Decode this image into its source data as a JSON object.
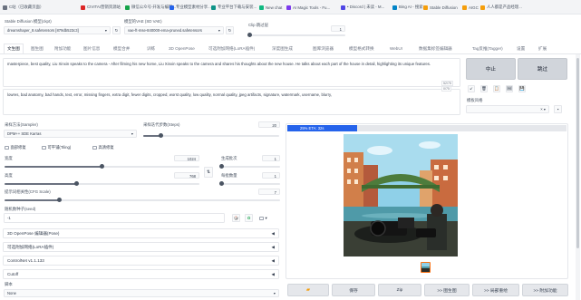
{
  "bookmarks": [
    {
      "label": "C站（已收藏页面）",
      "color": "#6b7280"
    },
    {
      "label": "CIVITAI营销资源站",
      "color": "#dc2626"
    },
    {
      "label": "微信公众号-开发与编辑...",
      "color": "#16a34a"
    },
    {
      "label": "专业模型素材分享...",
      "color": "#2563eb"
    },
    {
      "label": "专业平台下载与安装...",
      "color": "#0d9488"
    },
    {
      "label": "有工具站 - 网络课程...",
      "color": "#ea580c"
    },
    {
      "label": "New chat",
      "color": "#10b981"
    },
    {
      "label": "AI Magic Tools - Fu...",
      "color": "#7c3aed"
    },
    {
      "label": "• Discord | 未读 - M...",
      "color": "#4f46e5"
    },
    {
      "label": "Bing AI - 搜索",
      "color": "#0284c7"
    },
    {
      "label": "Stable Diffusion",
      "color": "#f59e0b"
    },
    {
      "label": "AIGC",
      "color": "#f59e0b"
    },
    {
      "label": "人人都是产品经理...",
      "color": "#f59e0b"
    }
  ],
  "header": {
    "checkpoint_label": "Stable Diffusion 模型(ckpt)",
    "checkpoint_value": "dreamshaper_8.safetensors [879db523c3]",
    "vae_label": "模型的VAE (SD VAE)",
    "vae_value": "vae-ft-mse-840000-ema-pruned.safetensors",
    "clip_label": "Clip 跳过层",
    "clip_value": "1"
  },
  "tabs": [
    {
      "label": "文生图",
      "active": true
    },
    {
      "label": "图生图",
      "active": false
    },
    {
      "label": "附加功能",
      "active": false
    },
    {
      "label": "图片信息",
      "active": false
    },
    {
      "label": "模型合并",
      "active": false
    },
    {
      "label": "训练",
      "active": false
    },
    {
      "label": "3D OpenPose",
      "active": false
    },
    {
      "label": "可选附加网络(LoRA插件)",
      "active": false
    },
    {
      "label": "深度图生成",
      "active": false
    },
    {
      "label": "图库浏览器",
      "active": false
    },
    {
      "label": "模型格式转换",
      "active": false
    },
    {
      "label": "WebUI",
      "active": false
    },
    {
      "label": "数据集标签编辑器",
      "active": false
    },
    {
      "label": "Tag反推(Tagger)",
      "active": false
    },
    {
      "label": "设置",
      "active": false
    },
    {
      "label": "扩展",
      "active": false
    }
  ],
  "prompt": {
    "positive": "masterpiece, best quality, Liu Xinxin speaks to the camera - After filming his new home, Liu Xinxin speaks to the camera and shares his thoughts about the new house. He talks about each part of the house in detail, highlighting its unique features.",
    "positive_count": "52/75",
    "negative": "lowres, bad anatomy, bad hands, text, error, missing fingers, extra digit, fewer digits, cropped, worst quality, low quality, normal quality, jpeg artifacts, signature, watermark, username, blurry,",
    "negative_count": "0/75"
  },
  "actions": {
    "generate": "生成",
    "interrupt": "中止",
    "skip": "跳过",
    "styles_label": "模板风格",
    "tool_icons": [
      "↙",
      "🗑",
      "📋",
      "🖼",
      "💾"
    ]
  },
  "params": {
    "sampler_label": "采样方法(Sampler)",
    "sampler_value": "DPM++ SDE Karras",
    "steps_label": "采样迭代步数(Steps)",
    "steps_value": "20",
    "steps_fraction": 0.13,
    "restore_faces": "面部修复",
    "tiling": "可平铺(Tiling)",
    "hires_fix": "高清修复",
    "width_label": "宽度",
    "width_value": "1024",
    "width_fraction": 0.5,
    "height_label": "高度",
    "height_value": "768",
    "height_fraction": 0.37,
    "batch_count_label": "生成批次",
    "batch_count_value": "1",
    "batch_count_fraction": 0,
    "batch_size_label": "每批数量",
    "batch_size_value": "1",
    "batch_size_fraction": 0,
    "cfg_label": "提示词相关性(CFG Scale)",
    "cfg_value": "7",
    "cfg_fraction": 0.2,
    "seed_label": "随机数种子(seed)",
    "seed_value": "-1"
  },
  "accordions": [
    "3D OpenPose 编辑器(Pose)",
    "可选附加网络(LoRA插件)",
    "ControlNet v1.1.133",
    "Cutoff"
  ],
  "script": {
    "label": "脚本",
    "value": "None"
  },
  "output": {
    "progress_text": "25% ETA: 32s",
    "progress": 0.25
  },
  "bottom_buttons": [
    {
      "label": "",
      "icon": "folder-icon"
    },
    {
      "label": "保存",
      "icon": ""
    },
    {
      "label": "Zip",
      "icon": ""
    },
    {
      "label": ">> 图生图",
      "icon": ""
    },
    {
      "label": ">> 局部重绘",
      "icon": ""
    },
    {
      "label": ">> 附加功能",
      "icon": ""
    }
  ],
  "colors": {
    "progress": "#2563eb",
    "accent": "#f97316"
  }
}
